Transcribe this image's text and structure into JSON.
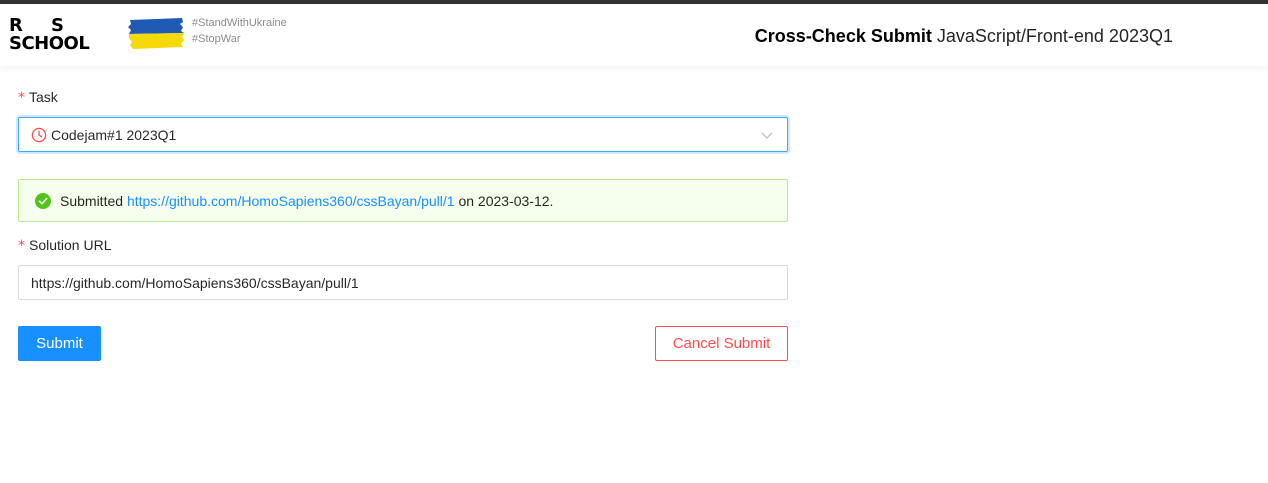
{
  "header": {
    "logo_line1_r": "R",
    "logo_line1_s": "S",
    "logo_line2": "SCHOOL",
    "tags": [
      "#StandWithUkraine",
      "#StopWar"
    ],
    "title_bold": "Cross-Check Submit",
    "title_rest": "JavaScript/Front-end 2023Q1",
    "flag_colors": {
      "top": "#1f5bb5",
      "bottom": "#f5d90a"
    }
  },
  "form": {
    "task": {
      "required_mark": "*",
      "label": "Task",
      "selected_value": "Codejam#1 2023Q1",
      "icon": "clock-icon",
      "icon_color": "#ff4d4f"
    },
    "alert": {
      "type": "success",
      "icon": "check-circle-icon",
      "prefix": "Submitted",
      "link_text": "https://github.com/HomoSapiens360/cssBayan/pull/1",
      "suffix": "on 2023-03-12."
    },
    "solution_url": {
      "required_mark": "*",
      "label": "Solution URL",
      "value": "https://github.com/HomoSapiens360/cssBayan/pull/1"
    },
    "submit_label": "Submit",
    "cancel_label": "Cancel Submit"
  },
  "colors": {
    "primary": "#1890ff",
    "danger": "#ff4d4f",
    "success": "#52c41a",
    "success_bg": "#f6ffed",
    "success_border": "#b7eb8f"
  }
}
